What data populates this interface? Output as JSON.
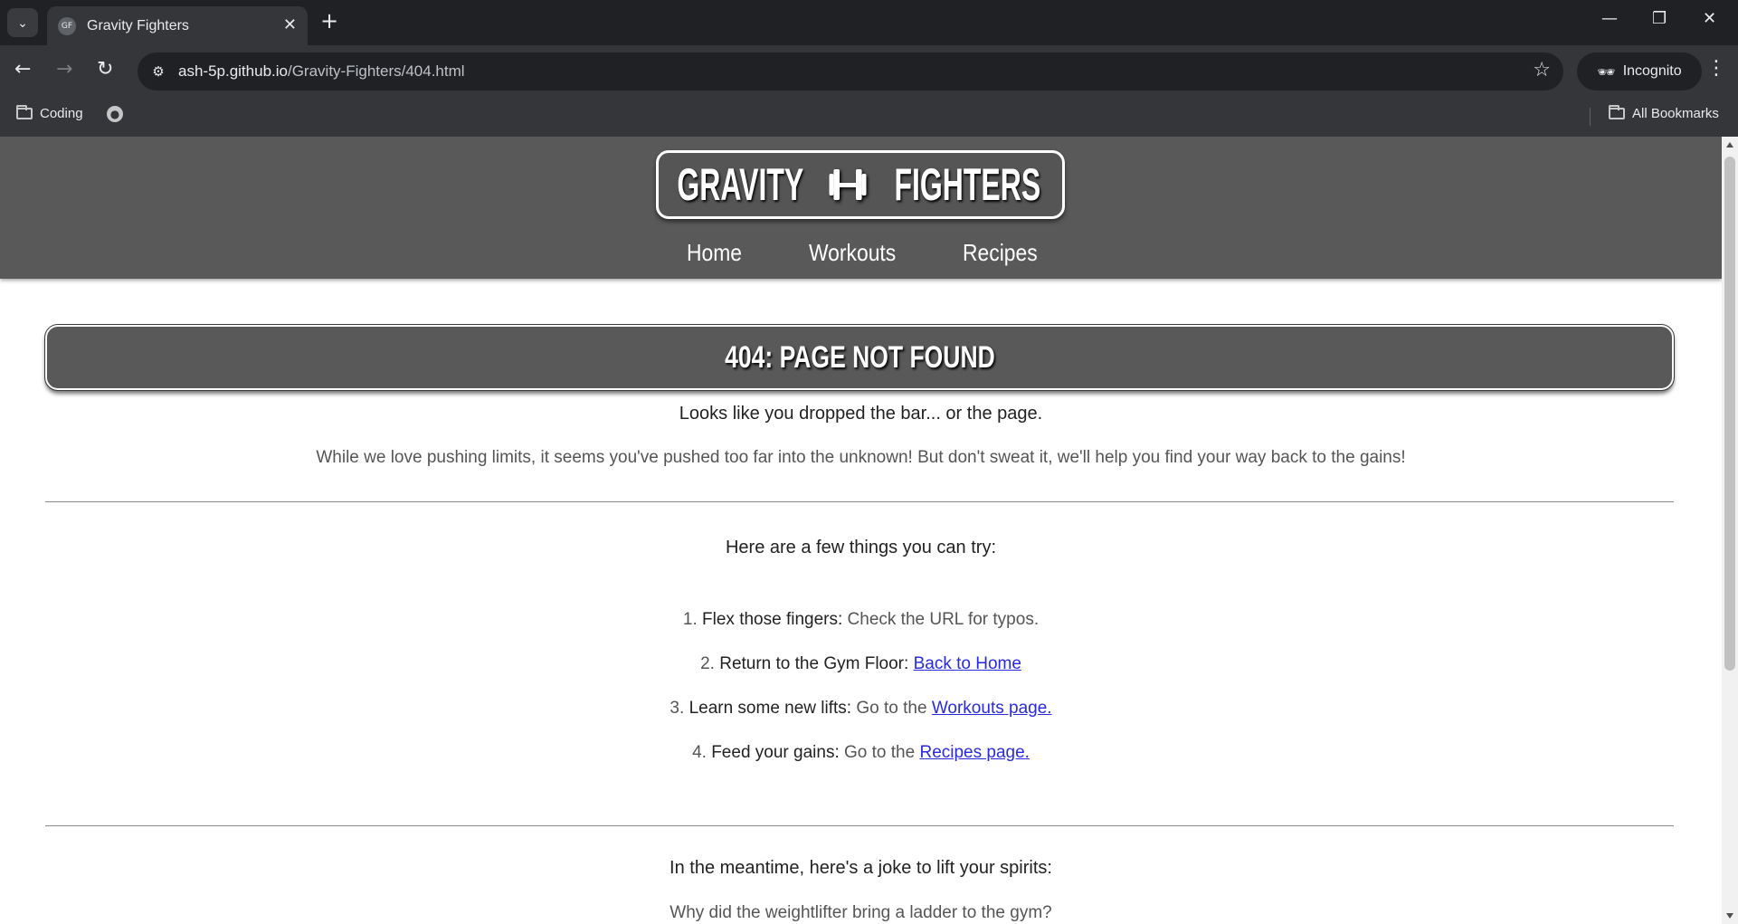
{
  "browser": {
    "tab_title": "Gravity Fighters",
    "favicon_text": "GF",
    "url_host": "ash-5p.github.io",
    "url_path": "/Gravity-Fighters/404.html",
    "incognito_label": "Incognito",
    "bookmarks": [
      {
        "label": "Coding"
      }
    ],
    "all_bookmarks_label": "All Bookmarks"
  },
  "site": {
    "logo_left": "GRAVITY",
    "logo_right": "FIGHTERS",
    "nav": [
      {
        "label": "Home"
      },
      {
        "label": "Workouts"
      },
      {
        "label": "Recipes"
      }
    ]
  },
  "page": {
    "title": "404: PAGE NOT FOUND",
    "lead": "Looks like you dropped the bar... or the page.",
    "body": "While we love pushing limits, it seems you've pushed too far into the unknown! But don't sweat it, we'll help you find your way back to the gains!",
    "try_heading": "Here are a few things you can try:",
    "steps": [
      {
        "num": "1.",
        "strong": "Flex those fingers:",
        "text": " Check the URL for typos.",
        "link": ""
      },
      {
        "num": "2.",
        "strong": "Return to the Gym Floor:",
        "text": " ",
        "link": "Back to Home"
      },
      {
        "num": "3.",
        "strong": "Learn some new lifts:",
        "text": " Go to the ",
        "link": "Workouts page."
      },
      {
        "num": "4.",
        "strong": "Feed your gains:",
        "text": " Go to the ",
        "link": "Recipes page."
      }
    ],
    "joke_heading": "In the meantime, here's a joke to lift your spirits:",
    "joke_question": "Why did the weightlifter bring a ladder to the gym?"
  },
  "colors": {
    "header_bg": "#595959",
    "link": "#2a2ae0"
  }
}
